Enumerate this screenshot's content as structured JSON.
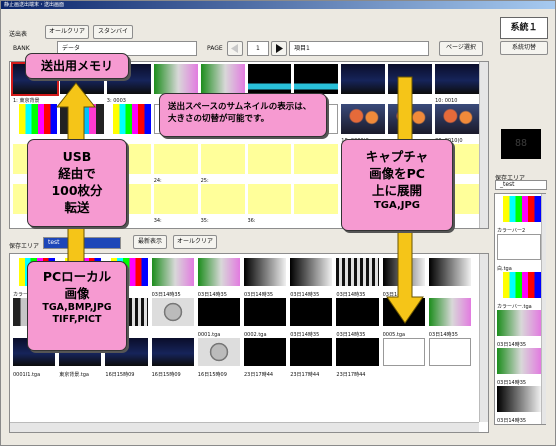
{
  "window": {
    "title": "静止画送出端末・送出画面"
  },
  "send": {
    "label": "送出表",
    "all_clear": "オールクリア",
    "standby": "スタンバイ",
    "bank_label": "BANK",
    "bank_value": "データ",
    "page_label": "PAGE",
    "page_value": "1",
    "page_title": "項目1",
    "page_select": "ページ選択"
  },
  "send_slots": [
    {
      "cap": "1: 東京背景",
      "style": "night"
    },
    {
      "cap": "",
      "style": "night"
    },
    {
      "cap": "3: 0003",
      "style": "night"
    },
    {
      "cap": "",
      "style": "green-pink"
    },
    {
      "cap": "",
      "style": "green-pink"
    },
    {
      "cap": "",
      "style": "black-cyan"
    },
    {
      "cap": "",
      "style": "black-cyan"
    },
    {
      "cap": "",
      "style": "night"
    },
    {
      "cap": "",
      "style": "night"
    },
    {
      "cap": "10: 0010",
      "style": "night"
    },
    {
      "cap": "",
      "style": "colorbar"
    },
    {
      "cap": "",
      "style": "bars"
    },
    {
      "cap": "",
      "style": "colorbar"
    },
    {
      "cap": "",
      "style": "empty"
    },
    {
      "cap": "",
      "style": "empty"
    },
    {
      "cap": "",
      "style": "empty"
    },
    {
      "cap": "",
      "style": "empty"
    },
    {
      "cap": "18: 0009(0",
      "style": "towers"
    },
    {
      "cap": "",
      "style": "towers"
    },
    {
      "cap": "20: 0010(0",
      "style": "towers"
    },
    {
      "cap": "",
      "style": "yellow"
    },
    {
      "cap": "",
      "style": "yellow"
    },
    {
      "cap": "",
      "style": "yellow"
    },
    {
      "cap": "24:",
      "style": "yellow"
    },
    {
      "cap": "25:",
      "style": "yellow"
    },
    {
      "cap": "",
      "style": "yellow"
    },
    {
      "cap": "",
      "style": "yellow"
    },
    {
      "cap": "28:",
      "style": "yellow"
    },
    {
      "cap": "",
      "style": "yellow"
    },
    {
      "cap": "",
      "style": "yellow"
    },
    {
      "cap": "",
      "style": "yellow"
    },
    {
      "cap": "",
      "style": "yellow"
    },
    {
      "cap": "",
      "style": "yellow"
    },
    {
      "cap": "34:",
      "style": "yellow"
    },
    {
      "cap": "35:",
      "style": "yellow"
    },
    {
      "cap": "36:",
      "style": "yellow"
    },
    {
      "cap": "",
      "style": "yellow"
    },
    {
      "cap": "38:",
      "style": "yellow"
    },
    {
      "cap": "",
      "style": "yellow"
    },
    {
      "cap": "",
      "style": "yellow"
    }
  ],
  "storage": {
    "label": "保存エリア",
    "select_value": "test",
    "refresh": "最新表示",
    "all_clear": "オールクリア"
  },
  "storage_items": [
    {
      "cap": "カラーバー",
      "style": "colorbar"
    },
    {
      "cap": "",
      "style": "colorbar"
    },
    {
      "cap": "",
      "style": "colorbar"
    },
    {
      "cap": "03日14時35",
      "style": "green-pink"
    },
    {
      "cap": "03日14時35",
      "style": "green-pink"
    },
    {
      "cap": "03日14時35",
      "style": "gray-ramp"
    },
    {
      "cap": "03日14時35",
      "style": "gray-ramp"
    },
    {
      "cap": "03日14時35",
      "style": "stripes"
    },
    {
      "cap": "03日14時35",
      "style": "gray-ramp"
    },
    {
      "cap": "",
      "style": "gray-ramp"
    },
    {
      "cap": "",
      "style": "bars"
    },
    {
      "cap": "",
      "style": "stripes"
    },
    {
      "cap": "",
      "style": "stripes"
    },
    {
      "cap": "",
      "style": "testcard"
    },
    {
      "cap": "0001.tga",
      "style": "black"
    },
    {
      "cap": "0002.tga",
      "style": "black"
    },
    {
      "cap": "03日14時35",
      "style": "black"
    },
    {
      "cap": "03日14時35",
      "style": "black"
    },
    {
      "cap": "0005.tga",
      "style": "black"
    },
    {
      "cap": "03日14時35",
      "style": "green-pink"
    },
    {
      "cap": "0001I1.tga",
      "style": "night"
    },
    {
      "cap": "東京背景.tga",
      "style": "night"
    },
    {
      "cap": "16日15時09",
      "style": "night"
    },
    {
      "cap": "16日15時09",
      "style": "night"
    },
    {
      "cap": "16日15時09",
      "style": "testcard"
    },
    {
      "cap": "23日17時44",
      "style": "black"
    },
    {
      "cap": "23日17時44",
      "style": "black"
    },
    {
      "cap": "23日17時44",
      "style": "black"
    },
    {
      "cap": "",
      "style": "empty"
    },
    {
      "cap": "",
      "style": "empty"
    }
  ],
  "right": {
    "system_label": "系統１",
    "system_switch": "系統切替",
    "counter": "88",
    "storage_label": "保存エリア",
    "select_value": "_test",
    "list": [
      {
        "cap": "カラーバー2",
        "style": "colorbar"
      },
      {
        "cap": "白.tga",
        "style": "empty"
      },
      {
        "cap": "カラーバー.tga",
        "style": "colorbar"
      },
      {
        "cap": "03日14時35",
        "style": "green-pink"
      },
      {
        "cap": "03日14時35",
        "style": "green-pink"
      },
      {
        "cap": "03日14時35",
        "style": "gray-ramp"
      }
    ]
  },
  "callouts": {
    "memory": "送出用メモリ",
    "thumb_note": "送出スペースのサムネイルの表示は、大きさの切替が可能です。",
    "usb": "USB\n経由で\n100枚分\n転送",
    "capture": "キャプチャ\n画像をPC\n上に展開",
    "capture_fmt": "TGA,JPG",
    "local": "PCローカル\n画像",
    "local_fmt": "TGA,BMP,JPG\nTIFF,PICT"
  },
  "colors": {
    "callout_pink": "#f69ad1",
    "arrow_yellow": "#f5c518",
    "slot_yellow": "#ffff9a",
    "selected_red": "#d21b1b"
  }
}
